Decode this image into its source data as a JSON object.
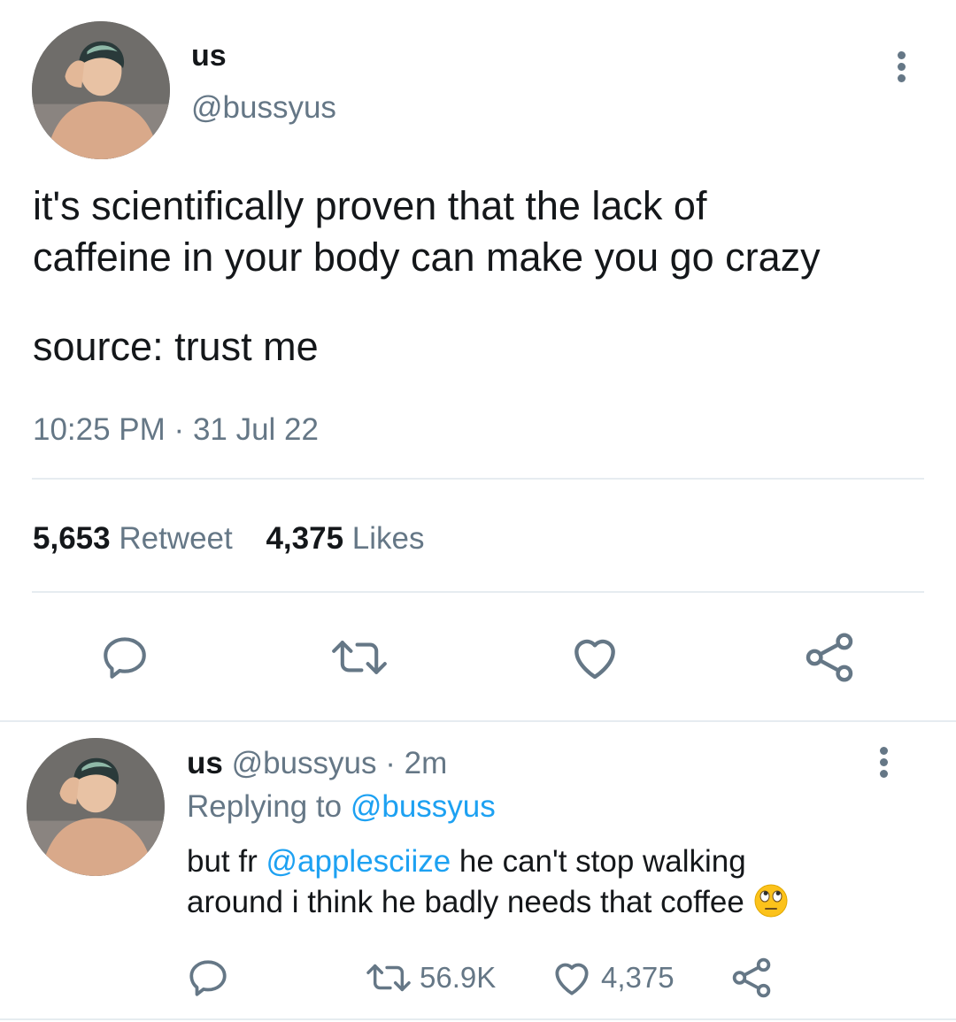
{
  "main_tweet": {
    "author": {
      "display_name": "us",
      "handle": "@bussyus"
    },
    "text_line1": "it's scientifically proven that the lack of",
    "text_line2": "caffeine in your body can make you go crazy",
    "text_line3": "source: trust me",
    "time": "10:25 PM",
    "separator": "·",
    "date": "31 Jul 22",
    "stats": {
      "retweets_count": "5,653",
      "retweets_label": "Retweet",
      "likes_count": "4,375",
      "likes_label": "Likes"
    },
    "actions": [
      "reply-icon",
      "retweet-icon",
      "heart-icon",
      "share-icon"
    ]
  },
  "reply_tweet": {
    "author": {
      "display_name": "us",
      "handle": "@bussyus"
    },
    "separator": "·",
    "time_ago": "2m",
    "replying_to_label": "Replying to",
    "replying_to_handle": "@bussyus",
    "text_prefix": "but fr",
    "mention": "@applesciize",
    "text_line1_rest": "he can't stop walking",
    "text_line2": "around i think he badly needs that coffee",
    "emoji": "face-with-rolling-eyes",
    "retweet_count": "56.9K",
    "like_count": "4,375"
  },
  "colors": {
    "text": "#14171a",
    "muted": "#657786",
    "link": "#1da1f2",
    "divider": "#e6ecf0"
  }
}
